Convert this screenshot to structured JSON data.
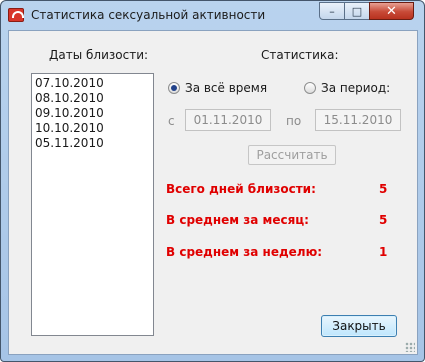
{
  "window": {
    "title": "Статистика сексуальной активности"
  },
  "controls": {
    "minimize": "–",
    "maximize": "□",
    "close": "✕"
  },
  "dates": {
    "label": "Даты близости:",
    "items": [
      "07.10.2010",
      "08.10.2010",
      "09.10.2010",
      "10.10.2010",
      "05.11.2010"
    ]
  },
  "stats": {
    "label": "Статистика:",
    "all_time": "За всё время",
    "period": "За период:",
    "selected": "all_time",
    "from_label": "с",
    "from_value": "01.11.2010",
    "to_label": "по",
    "to_value": "15.11.2010",
    "calculate_label": "Рассчитать"
  },
  "results": {
    "total_days_label": "Всего дней близости:",
    "total_days_value": "5",
    "per_month_label": "В среднем за месяц:",
    "per_month_value": "5",
    "per_week_label": "В среднем за неделю:",
    "per_week_value": "1"
  },
  "buttons": {
    "close_label": "Закрыть"
  },
  "colors": {
    "accent_red": "#e00000",
    "titlebar": "#b9d3ee"
  }
}
